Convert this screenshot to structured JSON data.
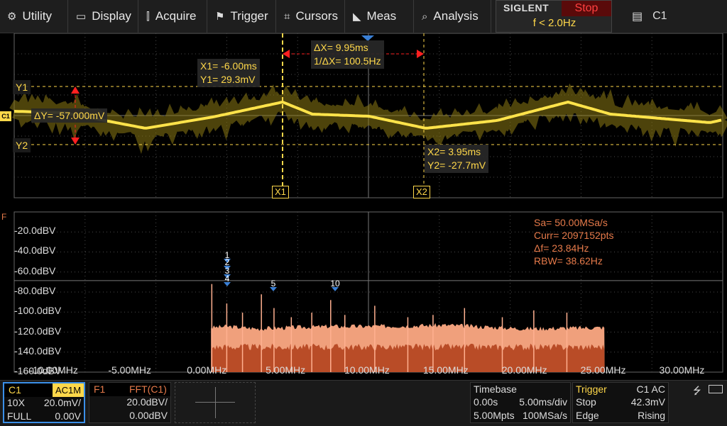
{
  "menu": [
    {
      "label": "Utility",
      "icon": "wrench-icon"
    },
    {
      "label": "Display",
      "icon": "monitor-icon"
    },
    {
      "label": "Acquire",
      "icon": "acquire-icon"
    },
    {
      "label": "Trigger",
      "icon": "flag-icon"
    },
    {
      "label": "Cursors",
      "icon": "crosshair-icon"
    },
    {
      "label": "Meas",
      "icon": "measure-icon"
    },
    {
      "label": "Analysis",
      "icon": "analysis-icon"
    }
  ],
  "brand": {
    "logo": "SIGLENT",
    "run_state": "Stop",
    "trigger_freq": "f < 2.0Hz"
  },
  "channel_select": {
    "label": "C1",
    "icon": "document-icon"
  },
  "colors": {
    "channel": "#ffd84a",
    "fft": "#e67a4a",
    "stop": "#ff4040",
    "marker": "#3a7fd4",
    "grid": "#4a4a4a"
  },
  "time_cursors": {
    "x1": {
      "label": "X1",
      "x": "X1= -6.00ms",
      "y": "Y1= 29.3mV"
    },
    "x2": {
      "label": "X2",
      "x": "X2= 3.95ms",
      "y": "Y2= -27.7mV"
    },
    "delta_x": "ΔX= 9.95ms",
    "inv_delta_x": "1/ΔX= 100.5Hz",
    "delta_y": "ΔY= -57.000mV",
    "y1_label": "Y1",
    "y2_label": "Y2",
    "channel_marker": "C1"
  },
  "fft": {
    "marker": "F",
    "info": {
      "sa": "Sa= 50.00MSa/s",
      "curr": "Curr= 2097152pts",
      "df": "Δf= 23.84Hz",
      "rbw": "RBW= 38.62Hz"
    },
    "db_labels": [
      "-20.0dBV",
      "-40.0dBV",
      "-60.0dBV",
      "-80.0dBV",
      "-100.0dBV",
      "-120.0dBV",
      "-140.0dBV",
      "-160.0dBV"
    ],
    "freq_labels": [
      "-10.00MHz",
      "-5.00MHz",
      "0.00MHz",
      "5.00MHz",
      "10.00MHz",
      "15.00MHz",
      "20.00MHz",
      "25.00MHz",
      "30.00MHz"
    ],
    "peak_markers": [
      "1",
      "2",
      "3",
      "4",
      "5",
      "10"
    ]
  },
  "chart_data": {
    "type": "line",
    "title": "",
    "x_unit": "MHz",
    "y_unit": "dBV",
    "xlim": [
      -12.5,
      32.5
    ],
    "ylim": [
      -160,
      -20
    ],
    "grid": true,
    "series": [
      {
        "x": [
          0,
          1.0,
          3.0,
          5.0,
          7.5,
          10.0,
          15.0,
          20.0,
          25.0
        ],
        "y": [
          -121,
          -120,
          -122,
          -121,
          -120,
          -120,
          -119,
          -122,
          -121
        ]
      }
    ]
  },
  "bottom": {
    "c1": {
      "label": "C1",
      "coupling": "AC1M",
      "probe": "10X",
      "scale": "20.0mV/",
      "bw": "FULL",
      "offset": "0.00V"
    },
    "f1": {
      "label": "F1",
      "source": "FFT(C1)",
      "scale": "20.0dBV/",
      "offset": "0.00dBV"
    },
    "timebase": {
      "label": "Timebase",
      "delay": "0.00s",
      "scale": "5.00ms/div",
      "memory": "5.00Mpts",
      "rate": "100MSa/s"
    },
    "trigger": {
      "label": "Trigger",
      "source": "C1 AC",
      "mode": "Stop",
      "level": "42.3mV",
      "type": "Edge",
      "slope": "Rising"
    },
    "usb_icon": "usb-icon",
    "battery_icon": "battery-icon"
  }
}
